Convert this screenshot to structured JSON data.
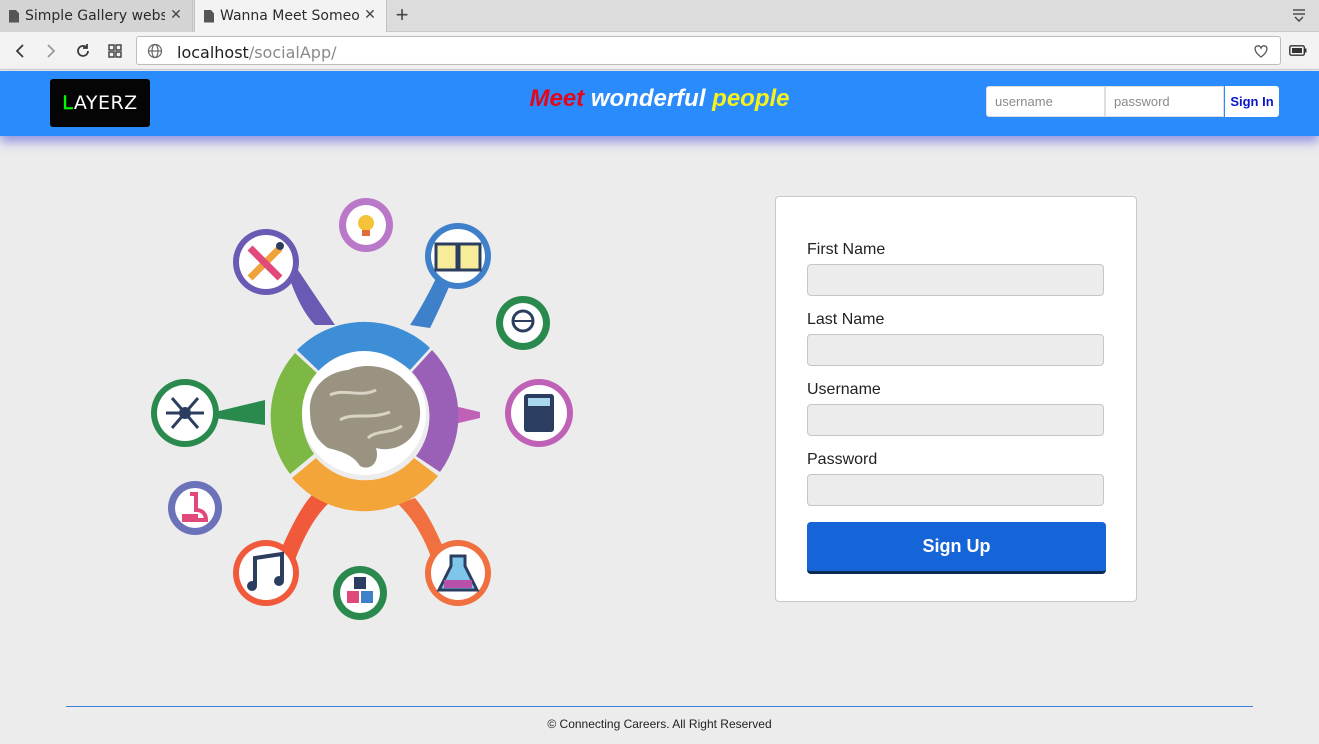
{
  "browser": {
    "tabs": [
      {
        "title": "Simple Gallery website",
        "active": false
      },
      {
        "title": "Wanna Meet Someone",
        "active": true
      }
    ],
    "url_host": "localhost",
    "url_path": "/socialApp/"
  },
  "header": {
    "logo_first": "L",
    "logo_rest": "AYERZ",
    "tagline_word1": "Meet",
    "tagline_word2": "wonderful",
    "tagline_word3": "people",
    "username_placeholder": "username",
    "password_placeholder": "password",
    "signin_label": "Sign In",
    "colors": {
      "bar": "#2a8bfc",
      "word1": "#e4061a",
      "word2": "#ffffff",
      "word3": "#f7f21b"
    }
  },
  "illustration": {
    "icons": [
      "brain-icon",
      "bulb-icon",
      "brush-pencil-icon",
      "book-icon",
      "globe-icon",
      "calculator-icon",
      "network-icon",
      "microscope-icon",
      "music-note-icon",
      "abc-blocks-icon",
      "flask-icon"
    ]
  },
  "signup": {
    "first_name_label": "First Name",
    "last_name_label": "Last Name",
    "username_label": "Username",
    "password_label": "Password",
    "submit_label": "Sign Up"
  },
  "footer": {
    "text": "© Connecting Careers. All Right Reserved"
  }
}
